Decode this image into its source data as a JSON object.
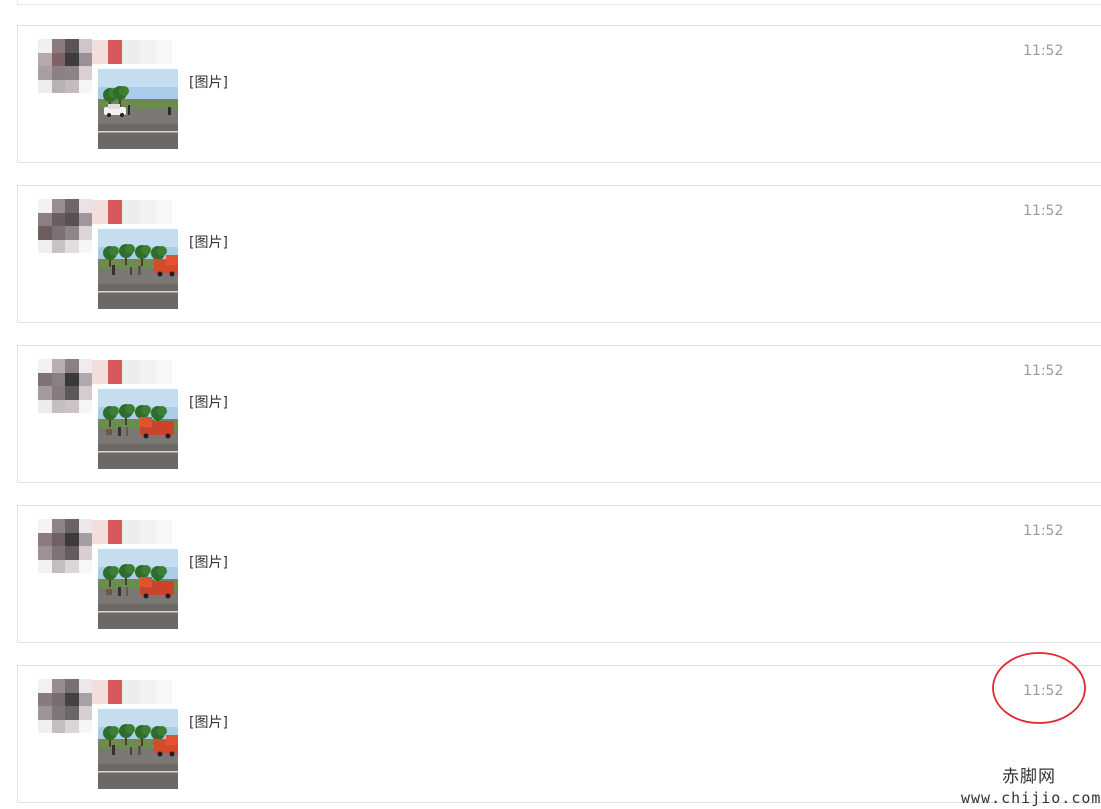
{
  "messages": [
    {
      "time": "11:52",
      "text": "[图片]",
      "photo_variant": "car"
    },
    {
      "time": "11:52",
      "text": "[图片]",
      "photo_variant": "truck-right"
    },
    {
      "time": "11:52",
      "text": "[图片]",
      "photo_variant": "truck-center"
    },
    {
      "time": "11:52",
      "text": "[图片]",
      "photo_variant": "truck-center"
    },
    {
      "time": "11:52",
      "text": "[图片]",
      "photo_variant": "truck-right"
    }
  ],
  "watermark": {
    "site_name": "赤脚网",
    "url": "www.chijio.com"
  },
  "colors": {
    "card_border": "#e3e3e3",
    "time_text": "#9b9b9b",
    "body_text": "#333333",
    "highlight_circle": "#e0282e",
    "name_accent": "#d9534f"
  },
  "icons": {
    "avatar": "pixelated-avatar",
    "name": "blurred-name"
  }
}
